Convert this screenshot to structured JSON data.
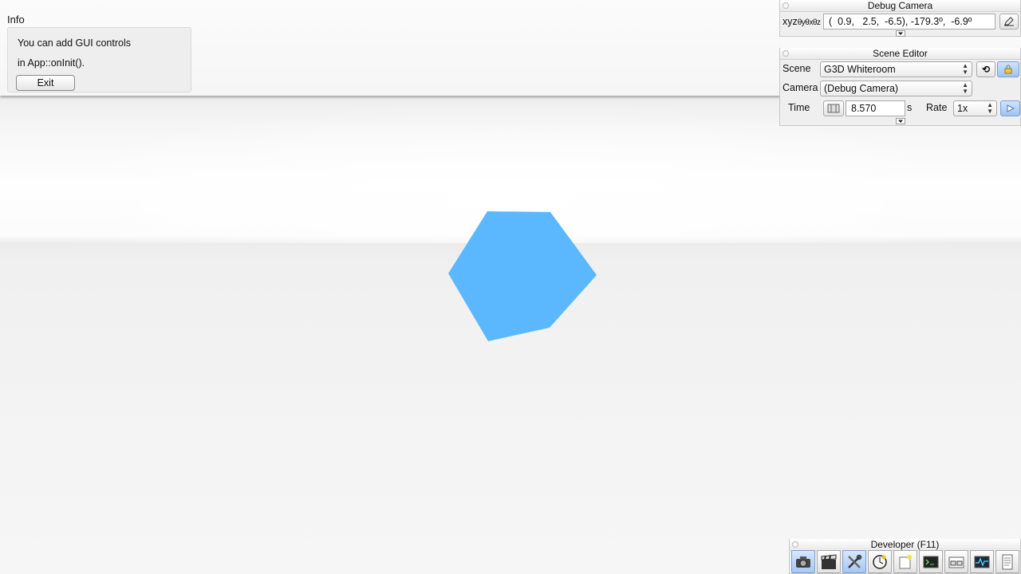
{
  "info_window": {
    "title": "Info",
    "line1": "You can add GUI controls",
    "line2": "in App::onInit().",
    "exit_label": "Exit"
  },
  "debug_camera": {
    "title": "Debug Camera",
    "xyz_label": "xyz",
    "angle_label": "θyθxθz",
    "frame_value": "(  0.9,   2.5,  -6.5), -179.3º,  -6.9º"
  },
  "scene_editor": {
    "title": "Scene Editor",
    "scene_label": "Scene",
    "scene_value": "G3D Whiteroom",
    "camera_label": "Camera",
    "camera_value": "(Debug Camera)",
    "time_label": "Time",
    "time_value": "8.570",
    "time_unit": "s",
    "rate_label": "Rate",
    "rate_value": "1x"
  },
  "developer": {
    "title": "Developer (F11)",
    "tools": [
      "camera-icon",
      "clapperboard-icon",
      "tools-icon",
      "clock-icon",
      "new-window-icon",
      "terminal-icon",
      "scene-graph-icon",
      "profiler-icon",
      "document-icon"
    ]
  },
  "colors": {
    "shape": "#5cb8fe",
    "active_button": "#a7c8f3"
  }
}
